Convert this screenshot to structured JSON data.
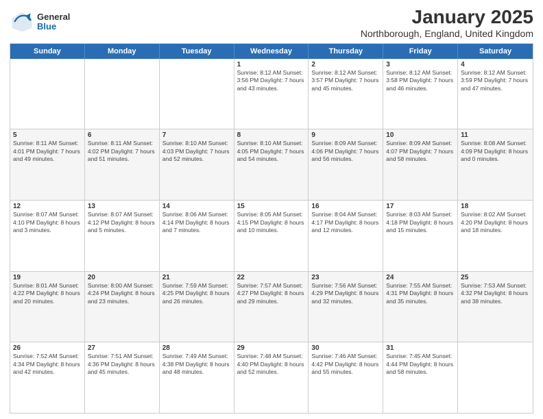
{
  "header": {
    "logo_general": "General",
    "logo_blue": "Blue",
    "month": "January 2025",
    "location": "Northborough, England, United Kingdom"
  },
  "weekdays": [
    "Sunday",
    "Monday",
    "Tuesday",
    "Wednesday",
    "Thursday",
    "Friday",
    "Saturday"
  ],
  "rows": [
    {
      "alt": false,
      "cells": [
        {
          "day": "",
          "text": ""
        },
        {
          "day": "",
          "text": ""
        },
        {
          "day": "",
          "text": ""
        },
        {
          "day": "1",
          "text": "Sunrise: 8:12 AM\nSunset: 3:56 PM\nDaylight: 7 hours and 43 minutes."
        },
        {
          "day": "2",
          "text": "Sunrise: 8:12 AM\nSunset: 3:57 PM\nDaylight: 7 hours and 45 minutes."
        },
        {
          "day": "3",
          "text": "Sunrise: 8:12 AM\nSunset: 3:58 PM\nDaylight: 7 hours and 46 minutes."
        },
        {
          "day": "4",
          "text": "Sunrise: 8:12 AM\nSunset: 3:59 PM\nDaylight: 7 hours and 47 minutes."
        }
      ]
    },
    {
      "alt": true,
      "cells": [
        {
          "day": "5",
          "text": "Sunrise: 8:11 AM\nSunset: 4:01 PM\nDaylight: 7 hours and 49 minutes."
        },
        {
          "day": "6",
          "text": "Sunrise: 8:11 AM\nSunset: 4:02 PM\nDaylight: 7 hours and 51 minutes."
        },
        {
          "day": "7",
          "text": "Sunrise: 8:10 AM\nSunset: 4:03 PM\nDaylight: 7 hours and 52 minutes."
        },
        {
          "day": "8",
          "text": "Sunrise: 8:10 AM\nSunset: 4:05 PM\nDaylight: 7 hours and 54 minutes."
        },
        {
          "day": "9",
          "text": "Sunrise: 8:09 AM\nSunset: 4:06 PM\nDaylight: 7 hours and 56 minutes."
        },
        {
          "day": "10",
          "text": "Sunrise: 8:09 AM\nSunset: 4:07 PM\nDaylight: 7 hours and 58 minutes."
        },
        {
          "day": "11",
          "text": "Sunrise: 8:08 AM\nSunset: 4:09 PM\nDaylight: 8 hours and 0 minutes."
        }
      ]
    },
    {
      "alt": false,
      "cells": [
        {
          "day": "12",
          "text": "Sunrise: 8:07 AM\nSunset: 4:10 PM\nDaylight: 8 hours and 3 minutes."
        },
        {
          "day": "13",
          "text": "Sunrise: 8:07 AM\nSunset: 4:12 PM\nDaylight: 8 hours and 5 minutes."
        },
        {
          "day": "14",
          "text": "Sunrise: 8:06 AM\nSunset: 4:14 PM\nDaylight: 8 hours and 7 minutes."
        },
        {
          "day": "15",
          "text": "Sunrise: 8:05 AM\nSunset: 4:15 PM\nDaylight: 8 hours and 10 minutes."
        },
        {
          "day": "16",
          "text": "Sunrise: 8:04 AM\nSunset: 4:17 PM\nDaylight: 8 hours and 12 minutes."
        },
        {
          "day": "17",
          "text": "Sunrise: 8:03 AM\nSunset: 4:18 PM\nDaylight: 8 hours and 15 minutes."
        },
        {
          "day": "18",
          "text": "Sunrise: 8:02 AM\nSunset: 4:20 PM\nDaylight: 8 hours and 18 minutes."
        }
      ]
    },
    {
      "alt": true,
      "cells": [
        {
          "day": "19",
          "text": "Sunrise: 8:01 AM\nSunset: 4:22 PM\nDaylight: 8 hours and 20 minutes."
        },
        {
          "day": "20",
          "text": "Sunrise: 8:00 AM\nSunset: 4:24 PM\nDaylight: 8 hours and 23 minutes."
        },
        {
          "day": "21",
          "text": "Sunrise: 7:59 AM\nSunset: 4:25 PM\nDaylight: 8 hours and 26 minutes."
        },
        {
          "day": "22",
          "text": "Sunrise: 7:57 AM\nSunset: 4:27 PM\nDaylight: 8 hours and 29 minutes."
        },
        {
          "day": "23",
          "text": "Sunrise: 7:56 AM\nSunset: 4:29 PM\nDaylight: 8 hours and 32 minutes."
        },
        {
          "day": "24",
          "text": "Sunrise: 7:55 AM\nSunset: 4:31 PM\nDaylight: 8 hours and 35 minutes."
        },
        {
          "day": "25",
          "text": "Sunrise: 7:53 AM\nSunset: 4:32 PM\nDaylight: 8 hours and 38 minutes."
        }
      ]
    },
    {
      "alt": false,
      "cells": [
        {
          "day": "26",
          "text": "Sunrise: 7:52 AM\nSunset: 4:34 PM\nDaylight: 8 hours and 42 minutes."
        },
        {
          "day": "27",
          "text": "Sunrise: 7:51 AM\nSunset: 4:36 PM\nDaylight: 8 hours and 45 minutes."
        },
        {
          "day": "28",
          "text": "Sunrise: 7:49 AM\nSunset: 4:38 PM\nDaylight: 8 hours and 48 minutes."
        },
        {
          "day": "29",
          "text": "Sunrise: 7:48 AM\nSunset: 4:40 PM\nDaylight: 8 hours and 52 minutes."
        },
        {
          "day": "30",
          "text": "Sunrise: 7:46 AM\nSunset: 4:42 PM\nDaylight: 8 hours and 55 minutes."
        },
        {
          "day": "31",
          "text": "Sunrise: 7:45 AM\nSunset: 4:44 PM\nDaylight: 8 hours and 58 minutes."
        },
        {
          "day": "",
          "text": ""
        }
      ]
    }
  ]
}
